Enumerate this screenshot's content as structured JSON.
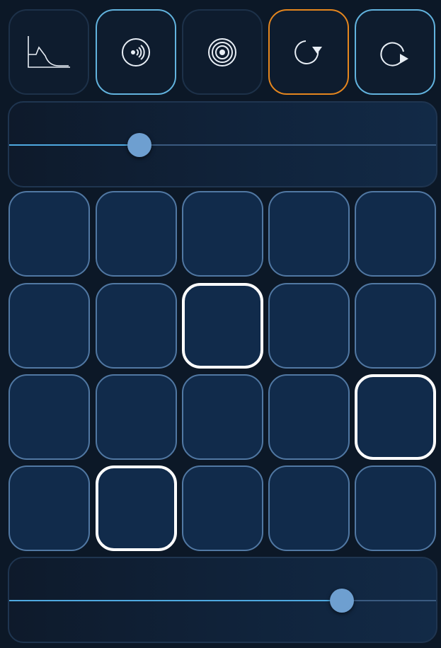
{
  "toolbar": {
    "buttons": [
      {
        "icon": "envelope-icon",
        "selected": false
      },
      {
        "icon": "sound-source-icon",
        "selected": true
      },
      {
        "icon": "concentric-rings-icon",
        "selected": false
      },
      {
        "icon": "rotate-down-icon",
        "selected": true,
        "accent": "orange"
      },
      {
        "icon": "rotate-right-icon",
        "selected": true
      }
    ]
  },
  "sliders": {
    "top": {
      "value": 0.305
    },
    "bottom": {
      "value": 0.78
    }
  },
  "grid": {
    "rows": 4,
    "cols": 5,
    "active": [
      [
        1,
        2
      ],
      [
        2,
        4
      ],
      [
        3,
        1
      ]
    ]
  },
  "colors": {
    "background": "#0c1827",
    "accent_blue": "#62b3de",
    "accent_orange": "#e5861e",
    "pad_fill": "#112b4b",
    "pad_border": "#5178a3",
    "pad_active_border": "#ffffff",
    "thumb": "#6e9fd0"
  }
}
